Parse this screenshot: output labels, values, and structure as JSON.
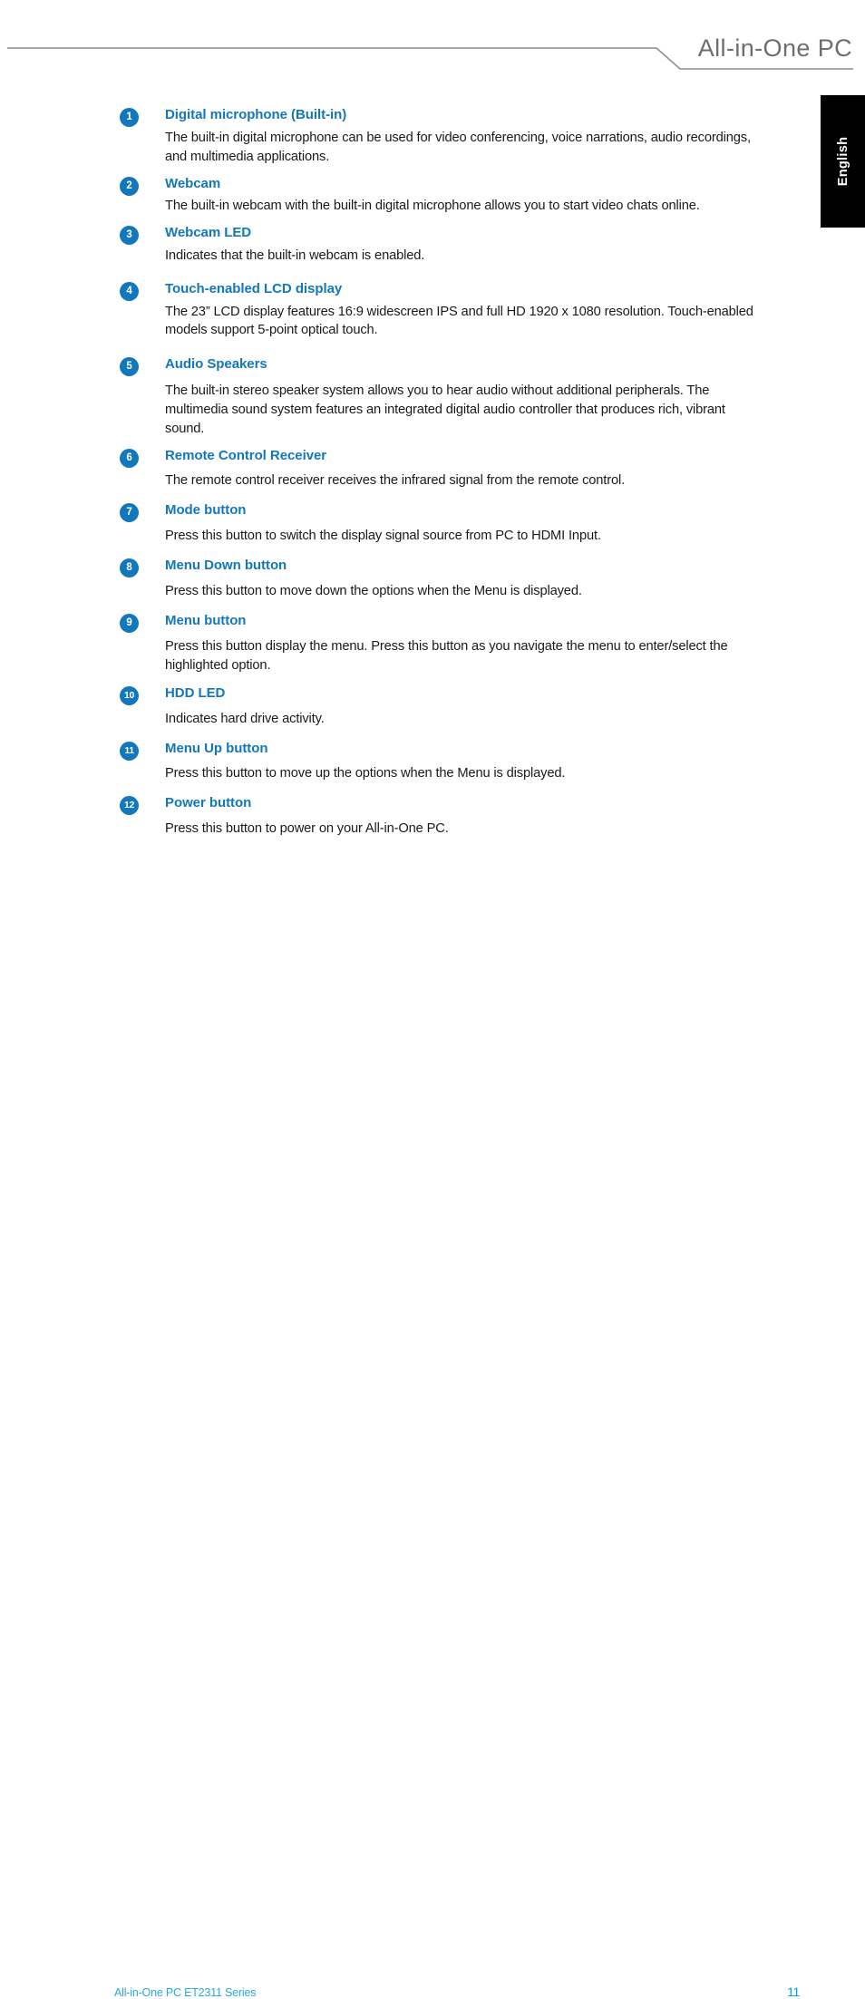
{
  "header": {
    "title": "All-in-One PC",
    "rule_color": "#8c8c90"
  },
  "language_tab": {
    "label": "English",
    "background": "#000000",
    "text_color": "#ffffff"
  },
  "theme": {
    "heading_blue": "#1277bb",
    "badge_blue": "#1277bb",
    "footer_blue": "#29a8e0",
    "page_number_blue": "#00a2e8",
    "body_text": "#1a1a1a"
  },
  "features": [
    {
      "number": "1",
      "title": "Digital microphone (Built-in)",
      "description": "The built-in digital microphone can be used for video conferencing, voice narrations, audio recordings, and multimedia applications."
    },
    {
      "number": "2",
      "title": "Webcam",
      "description": "The built-in webcam with the built-in digital microphone allows you to start video chats online."
    },
    {
      "number": "3",
      "title": "Webcam LED",
      "description": "Indicates that the built-in webcam is enabled."
    },
    {
      "number": "4",
      "title": "Touch-enabled LCD display",
      "description": "The 23” LCD display features 16:9 widescreen IPS and full HD 1920 x 1080 resolution. Touch-enabled models support 5-point optical touch."
    },
    {
      "number": "5",
      "title": "Audio Speakers",
      "description": "The built-in stereo speaker system allows you to hear audio without additional peripherals. The multimedia sound system features an integrated digital audio controller that produces rich, vibrant sound."
    },
    {
      "number": "6",
      "title": "Remote Control Receiver",
      "description": "The remote control receiver receives the infrared signal from the remote control."
    },
    {
      "number": "7",
      "title": "Mode button",
      "description": "Press this button to switch the display signal source from PC to HDMI Input."
    },
    {
      "number": "8",
      "title": "Menu Down button",
      "description": "Press this button to move down the options when the Menu is displayed."
    },
    {
      "number": "9",
      "title": "Menu button",
      "description": "Press this button display the menu. Press this button as you navigate the menu to enter/select the highlighted option."
    },
    {
      "number": "10",
      "title": "HDD LED",
      "description": "Indicates hard drive activity."
    },
    {
      "number": "11",
      "title": "Menu Up button",
      "description": "Press this button to move up the options when the Menu is displayed."
    },
    {
      "number": "12",
      "title": "Power button",
      "description": "Press this button to power on your All-in-One PC."
    }
  ],
  "footer": {
    "left_text": "All-in-One PC ET2311 Series",
    "page_number": "11"
  }
}
